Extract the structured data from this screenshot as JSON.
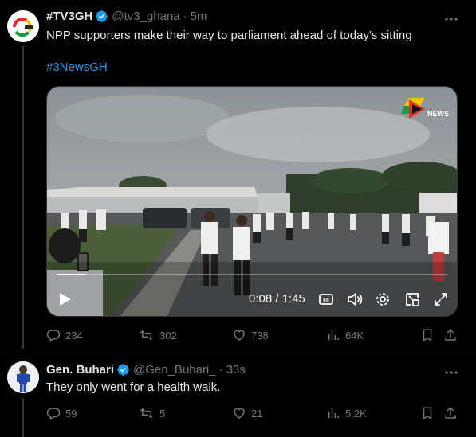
{
  "tweets": [
    {
      "display_name": "#TV3GH",
      "handle": "@tv3_ghana",
      "time": "5m",
      "time_prefix": "·",
      "text": "NPP supporters make their way to parliament ahead of today's sitting",
      "hashtag": "#3NewsGH",
      "media": {
        "channel_logo_text": "NEWS",
        "timecode": "0:08 / 1:45",
        "progress": 0.076
      },
      "stats": {
        "replies": "234",
        "reposts": "302",
        "likes": "738",
        "views": "64K"
      }
    },
    {
      "display_name": "Gen. Buhari",
      "handle": "@Gen_Buhari_",
      "time": "33s",
      "time_prefix": "·",
      "text": "They only went for a health walk.",
      "stats": {
        "replies": "59",
        "reposts": "5",
        "likes": "21",
        "views": "5.2K"
      }
    }
  ],
  "colors": {
    "background": "#000000",
    "text": "#e7e9ea",
    "secondary": "#71767b",
    "link": "#1d9bf0",
    "verified": "#1d9bf0",
    "border": "#2f3336"
  }
}
